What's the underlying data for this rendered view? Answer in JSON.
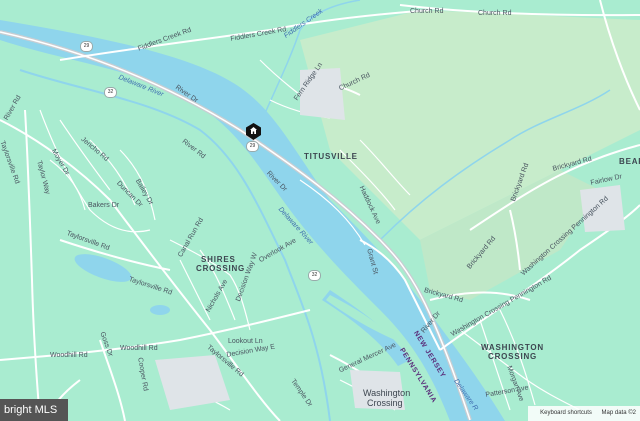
{
  "map": {
    "colors": {
      "land": "#a9ecd0",
      "river": "#8fd5ec",
      "park": "#c7eccb",
      "road": "#ffffff",
      "highway": "#c8cdd2"
    },
    "places": {
      "titusville": "TITUSVILLE",
      "shires_crossing_1": "SHIRES",
      "shires_crossing_2": "CROSSING",
      "washington_crossing_1": "WASHINGTON",
      "washington_crossing_2": "CROSSING",
      "washington_crossing_town_1": "Washington",
      "washington_crossing_town_2": "Crossing",
      "bear": "BEAR",
      "new_jersey": "NEW JERSEY",
      "pennsylvania": "PENNSYLVANIA"
    },
    "water": {
      "delaware_river_upper": "Delaware River",
      "delaware_river_mid": "Delaware River",
      "delaware_river_lower": "Delaware R",
      "fiddlers_creek": "Fiddlers Creek"
    },
    "roads": {
      "fiddlers_creek_rd_1": "Fiddlers Creek Rd",
      "fiddlers_creek_rd_2": "Fiddlers Creek Rd",
      "church_rd_top": "Church Rd",
      "church_rd_top2": "Church Rd",
      "church_rd": "Church Rd",
      "river_rd_nj_top": "River Dr",
      "river_rd_pa": "River Rd",
      "river_rd_pa2": "River Rd",
      "river_dr": "River Dr",
      "taylorsville_rd_1": "Taylorsville Rd",
      "taylorsville_rd_2": "Taylorsville Rd",
      "taylorsville_rd_3": "Taylorsville Rd",
      "taylorsville_rd_4": "Taylorsville Rd",
      "woodhill_rd_1": "Woodhill Rd",
      "woodhill_rd_2": "Woodhill Rd",
      "jericho_rd": "Jericho Rd",
      "bakers_dr": "Bakers Dr",
      "duncan_dr": "Duncan Dr",
      "bailey_dr": "Bailey Dr",
      "moyer_dr": "Moyer Dr",
      "tayler_way": "Taylor Way",
      "fern_ridge_ln": "Fern Ridge Ln",
      "washington_crossing_pennington_rd": "Washington Crossing Pennington Rd",
      "washington_crossing_pennington_rd2": "Washington Crossing Pennington Rd",
      "brickyard_rd_1": "Brickyard Rd",
      "brickyard_rd_2": "Brickyard Rd",
      "brickyard_rd_3": "Brickyard Rd",
      "brickyard_rd_4": "Brickyard Rd",
      "fairlow_dr": "Fairlow Dr",
      "haddock_ave": "Haddock Ave",
      "grant_st": "Grant St",
      "overlook_ave": "Overlook Ave",
      "canal_run_rd": "Canal Run Rd",
      "nichols_ave": "Nichols Ave",
      "decision_way_e": "Decision Way E",
      "decision_way_w": "Decision Way W",
      "lookout_ln": "Lookout Ln",
      "general_mercer_ave": "General Mercer Ave",
      "temple_dr": "Temple Dr",
      "pattenson_ave": "Patterson Ave",
      "morgan_ave": "Morgan Ave",
      "river_dr_low": "River Dr",
      "cooper_rd": "Cooper Rd",
      "goss_dr": "Goss Dr"
    },
    "shields": {
      "route_29_a": "29",
      "route_32": "32",
      "route_29_b": "29",
      "route_32_b": "32"
    },
    "marker_icon": "house-marker-icon",
    "attribution": {
      "logo_text": "bright MLS",
      "keyboard_shortcuts": "Keyboard shortcuts",
      "map_data": "Map data ©2"
    }
  }
}
